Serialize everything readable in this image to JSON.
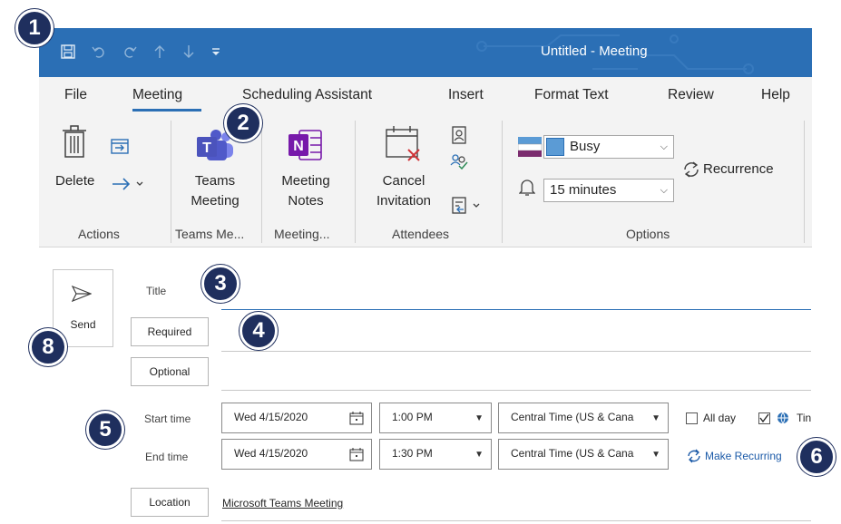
{
  "window": {
    "title": "Untitled  -  Meeting",
    "qat": {
      "save": "save-icon",
      "undo": "undo-icon",
      "redo": "redo-icon",
      "up": "up-arrow-icon",
      "down": "down-arrow-icon",
      "customize": "customize-icon"
    }
  },
  "tabs": [
    {
      "label": "File"
    },
    {
      "label": "Meeting"
    },
    {
      "label": "Scheduling Assistant"
    },
    {
      "label": "Insert"
    },
    {
      "label": "Format Text"
    },
    {
      "label": "Review"
    },
    {
      "label": "Help"
    }
  ],
  "ribbon": {
    "actions": {
      "delete_label": "Delete",
      "group": "Actions"
    },
    "teams": {
      "label_line1": "Teams",
      "label_line2": "Meeting",
      "group": "Teams Me..."
    },
    "notes": {
      "label_line1": "Meeting",
      "label_line2": "Notes",
      "group": "Meeting..."
    },
    "attendees": {
      "cancel_line1": "Cancel",
      "cancel_line2": "Invitation",
      "group": "Attendees"
    },
    "options": {
      "show_as": "Busy",
      "reminder": "15 minutes",
      "recurrence": "Recurrence",
      "group": "Options"
    }
  },
  "form": {
    "send": "Send",
    "title_label": "Title",
    "required": "Required",
    "optional": "Optional",
    "start_label": "Start time",
    "end_label": "End time",
    "start_date": "Wed 4/15/2020",
    "start_time": "1:00 PM",
    "end_date": "Wed 4/15/2020",
    "end_time": "1:30 PM",
    "timezone": "Central Time (US & Cana",
    "all_day": "All day",
    "time_zones": "Tin",
    "make_recurring": "Make Recurring",
    "location_btn": "Location",
    "location_value": "Microsoft Teams Meeting"
  },
  "badges": [
    "1",
    "2",
    "3",
    "4",
    "5",
    "6",
    "8"
  ],
  "colors": {
    "accent": "#2b6fb5",
    "badge": "#1f2f5e",
    "teams": "#5059c9",
    "onenote": "#7719aa",
    "busy": "#5b9bd5"
  }
}
